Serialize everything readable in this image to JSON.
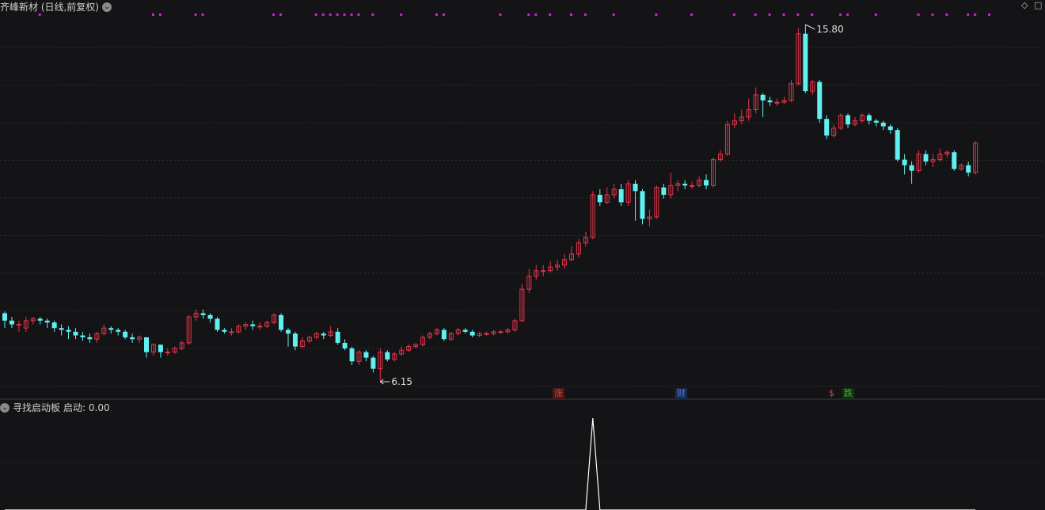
{
  "main_panel": {
    "title": "齐峰新材 (日线,前复权)",
    "high_label": "15.80",
    "low_label": "6.15"
  },
  "indicator_panel": {
    "title": "寻找启动板",
    "value_label": "启动: 0.00"
  },
  "event_tags": [
    {
      "text": "涨",
      "color": "#e04040"
    },
    {
      "text": "财",
      "color": "#4a7ad8"
    },
    {
      "text": "$",
      "color": "#e04040"
    },
    {
      "text": "跌",
      "color": "#30c030"
    }
  ],
  "colors": {
    "background": "#141416",
    "up": "#e5364a",
    "down": "#5ff0f0",
    "signal_dots": "#d020d0",
    "grid": "#2e2e2e",
    "indicator_line": "#ffffff"
  },
  "chart_data": {
    "type": "candlestick",
    "price_range": [
      6.15,
      15.8
    ],
    "candles": [
      [
        8.0,
        7.8,
        8.05,
        7.6
      ],
      [
        7.8,
        7.7,
        7.9,
        7.6
      ],
      [
        7.7,
        7.7,
        7.8,
        7.5
      ],
      [
        7.6,
        7.8,
        7.9,
        7.5
      ],
      [
        7.8,
        7.85,
        7.9,
        7.7
      ],
      [
        7.85,
        7.8,
        7.9,
        7.7
      ],
      [
        7.8,
        7.75,
        7.85,
        7.6
      ],
      [
        7.75,
        7.6,
        7.8,
        7.5
      ],
      [
        7.6,
        7.55,
        7.7,
        7.4
      ],
      [
        7.55,
        7.5,
        7.65,
        7.3
      ],
      [
        7.5,
        7.4,
        7.6,
        7.3
      ],
      [
        7.4,
        7.35,
        7.5,
        7.25
      ],
      [
        7.35,
        7.3,
        7.45,
        7.2
      ],
      [
        7.3,
        7.45,
        7.5,
        7.2
      ],
      [
        7.45,
        7.6,
        7.7,
        7.4
      ],
      [
        7.6,
        7.55,
        7.65,
        7.45
      ],
      [
        7.55,
        7.5,
        7.6,
        7.4
      ],
      [
        7.5,
        7.35,
        7.55,
        7.3
      ],
      [
        7.35,
        7.3,
        7.45,
        7.2
      ],
      [
        7.3,
        7.35,
        7.4,
        7.2
      ],
      [
        7.35,
        6.95,
        7.35,
        6.8
      ],
      [
        6.95,
        7.15,
        7.2,
        6.85
      ],
      [
        7.15,
        6.95,
        7.15,
        6.8
      ],
      [
        6.95,
        6.95,
        7.05,
        6.85
      ],
      [
        6.95,
        7.05,
        7.1,
        6.9
      ],
      [
        7.05,
        7.2,
        7.25,
        7.0
      ],
      [
        7.2,
        7.9,
        7.95,
        7.15
      ],
      [
        7.9,
        8.0,
        8.1,
        7.8
      ],
      [
        8.0,
        7.95,
        8.1,
        7.85
      ],
      [
        7.95,
        7.85,
        8.0,
        7.75
      ],
      [
        7.85,
        7.55,
        7.9,
        7.5
      ],
      [
        7.55,
        7.5,
        7.6,
        7.45
      ],
      [
        7.5,
        7.5,
        7.6,
        7.4
      ],
      [
        7.5,
        7.65,
        7.7,
        7.45
      ],
      [
        7.65,
        7.7,
        7.75,
        7.55
      ],
      [
        7.7,
        7.65,
        7.8,
        7.55
      ],
      [
        7.65,
        7.65,
        7.75,
        7.55
      ],
      [
        7.65,
        7.75,
        7.8,
        7.6
      ],
      [
        7.75,
        7.95,
        8.0,
        7.7
      ],
      [
        7.95,
        7.55,
        8.0,
        7.5
      ],
      [
        7.55,
        7.45,
        7.6,
        7.1
      ],
      [
        7.45,
        7.1,
        7.5,
        7.0
      ],
      [
        7.1,
        7.25,
        7.35,
        7.05
      ],
      [
        7.25,
        7.35,
        7.4,
        7.2
      ],
      [
        7.35,
        7.45,
        7.5,
        7.3
      ],
      [
        7.45,
        7.4,
        7.5,
        7.3
      ],
      [
        7.4,
        7.5,
        7.65,
        7.35
      ],
      [
        7.5,
        7.2,
        7.6,
        7.15
      ],
      [
        7.2,
        7.05,
        7.3,
        7.0
      ],
      [
        7.05,
        6.7,
        7.1,
        6.6
      ],
      [
        6.7,
        6.95,
        7.0,
        6.6
      ],
      [
        6.95,
        6.8,
        7.0,
        6.7
      ],
      [
        6.8,
        6.5,
        6.85,
        6.4
      ],
      [
        6.5,
        6.95,
        7.05,
        6.15
      ],
      [
        6.95,
        6.75,
        7.0,
        6.7
      ],
      [
        6.75,
        6.9,
        6.95,
        6.7
      ],
      [
        6.9,
        7.0,
        7.1,
        6.85
      ],
      [
        7.0,
        7.1,
        7.15,
        6.95
      ],
      [
        7.1,
        7.15,
        7.2,
        7.05
      ],
      [
        7.15,
        7.35,
        7.4,
        7.1
      ],
      [
        7.35,
        7.45,
        7.5,
        7.3
      ],
      [
        7.45,
        7.55,
        7.6,
        7.4
      ],
      [
        7.55,
        7.3,
        7.6,
        7.25
      ],
      [
        7.3,
        7.45,
        7.5,
        7.25
      ],
      [
        7.45,
        7.55,
        7.6,
        7.4
      ],
      [
        7.55,
        7.5,
        7.6,
        7.45
      ],
      [
        7.5,
        7.4,
        7.55,
        7.35
      ],
      [
        7.4,
        7.45,
        7.5,
        7.35
      ],
      [
        7.45,
        7.45,
        7.5,
        7.4
      ],
      [
        7.45,
        7.5,
        7.55,
        7.4
      ],
      [
        7.5,
        7.5,
        7.55,
        7.45
      ],
      [
        7.5,
        7.55,
        7.6,
        7.45
      ],
      [
        7.55,
        7.8,
        7.85,
        7.5
      ],
      [
        7.8,
        8.65,
        8.8,
        7.75
      ],
      [
        8.65,
        9.0,
        9.2,
        8.55
      ],
      [
        9.0,
        9.15,
        9.3,
        8.9
      ],
      [
        9.15,
        9.15,
        9.3,
        9.0
      ],
      [
        9.15,
        9.25,
        9.4,
        9.1
      ],
      [
        9.25,
        9.3,
        9.45,
        9.15
      ],
      [
        9.3,
        9.45,
        9.6,
        9.2
      ],
      [
        9.45,
        9.6,
        9.8,
        9.4
      ],
      [
        9.6,
        9.9,
        10.0,
        9.5
      ],
      [
        9.9,
        10.05,
        10.2,
        9.8
      ],
      [
        10.05,
        11.2,
        11.3,
        10.0
      ],
      [
        11.2,
        11.0,
        11.35,
        10.9
      ],
      [
        11.0,
        11.2,
        11.4,
        10.95
      ],
      [
        11.2,
        11.35,
        11.5,
        11.1
      ],
      [
        11.35,
        11.0,
        11.5,
        10.9
      ],
      [
        11.0,
        11.5,
        11.6,
        10.9
      ],
      [
        11.5,
        11.3,
        11.6,
        10.5
      ],
      [
        11.3,
        10.55,
        11.35,
        10.4
      ],
      [
        10.55,
        10.6,
        10.8,
        10.35
      ],
      [
        10.6,
        11.4,
        11.45,
        10.55
      ],
      [
        11.4,
        11.2,
        11.5,
        11.1
      ],
      [
        11.2,
        11.45,
        11.8,
        11.1
      ],
      [
        11.45,
        11.5,
        11.6,
        11.3
      ],
      [
        11.5,
        11.45,
        11.6,
        11.35
      ],
      [
        11.45,
        11.45,
        11.55,
        11.35
      ],
      [
        11.45,
        11.6,
        11.7,
        11.4
      ],
      [
        11.6,
        11.45,
        11.75,
        11.35
      ],
      [
        11.45,
        12.15,
        12.2,
        11.4
      ],
      [
        12.15,
        12.3,
        12.4,
        12.1
      ],
      [
        12.3,
        13.1,
        13.2,
        12.25
      ],
      [
        13.1,
        13.2,
        13.4,
        13.0
      ],
      [
        13.2,
        13.3,
        13.5,
        13.1
      ],
      [
        13.3,
        13.5,
        13.8,
        13.2
      ],
      [
        13.5,
        13.9,
        14.1,
        13.4
      ],
      [
        13.9,
        13.75,
        13.95,
        13.3
      ],
      [
        13.75,
        13.7,
        13.85,
        13.6
      ],
      [
        13.7,
        13.7,
        13.8,
        13.6
      ],
      [
        13.7,
        13.75,
        13.85,
        13.65
      ],
      [
        13.75,
        14.2,
        14.3,
        13.7
      ],
      [
        14.2,
        15.55,
        15.7,
        14.15
      ],
      [
        15.55,
        14.0,
        15.8,
        13.95
      ],
      [
        14.0,
        14.25,
        14.3,
        13.9
      ],
      [
        14.25,
        13.25,
        14.3,
        13.15
      ],
      [
        13.25,
        12.8,
        13.35,
        12.7
      ],
      [
        12.8,
        13.0,
        13.1,
        12.75
      ],
      [
        13.0,
        13.35,
        13.4,
        12.95
      ],
      [
        13.35,
        13.1,
        13.4,
        13.0
      ],
      [
        13.1,
        13.2,
        13.3,
        13.05
      ],
      [
        13.2,
        13.35,
        13.4,
        13.15
      ],
      [
        13.35,
        13.2,
        13.4,
        13.1
      ],
      [
        13.2,
        13.15,
        13.25,
        13.05
      ],
      [
        13.15,
        13.05,
        13.2,
        12.95
      ],
      [
        13.05,
        12.95,
        13.1,
        12.85
      ],
      [
        12.95,
        12.15,
        13.0,
        12.1
      ],
      [
        12.15,
        12.0,
        12.3,
        11.75
      ],
      [
        12.0,
        11.85,
        12.1,
        11.5
      ],
      [
        11.85,
        12.3,
        12.4,
        11.8
      ],
      [
        12.3,
        12.1,
        12.4,
        12.0
      ],
      [
        12.1,
        12.15,
        12.3,
        11.95
      ],
      [
        12.15,
        12.3,
        12.45,
        12.1
      ],
      [
        12.3,
        12.35,
        12.4,
        12.2
      ],
      [
        12.35,
        11.9,
        12.4,
        11.85
      ],
      [
        11.9,
        12.0,
        12.05,
        11.85
      ],
      [
        12.0,
        11.8,
        12.1,
        11.7
      ],
      [
        11.8,
        12.6,
        12.65,
        11.75
      ]
    ],
    "signal_dot_rows": [
      {
        "bar_indices": [
          5,
          21,
          22,
          27,
          28,
          38,
          39,
          45,
          46,
          49,
          50,
          52,
          56,
          61,
          62,
          70,
          75,
          82,
          86,
          92,
          103,
          106,
          108,
          110,
          112,
          114,
          118,
          119,
          123,
          129,
          133,
          137
        ]
      },
      {
        "bar_indices": [
          44,
          47,
          48,
          74,
          77,
          80,
          97,
          131,
          136,
          139
        ]
      }
    ],
    "indicator": {
      "name": "启动",
      "values_nonzero": [
        {
          "bar_index": 83,
          "value": 1
        }
      ]
    }
  }
}
